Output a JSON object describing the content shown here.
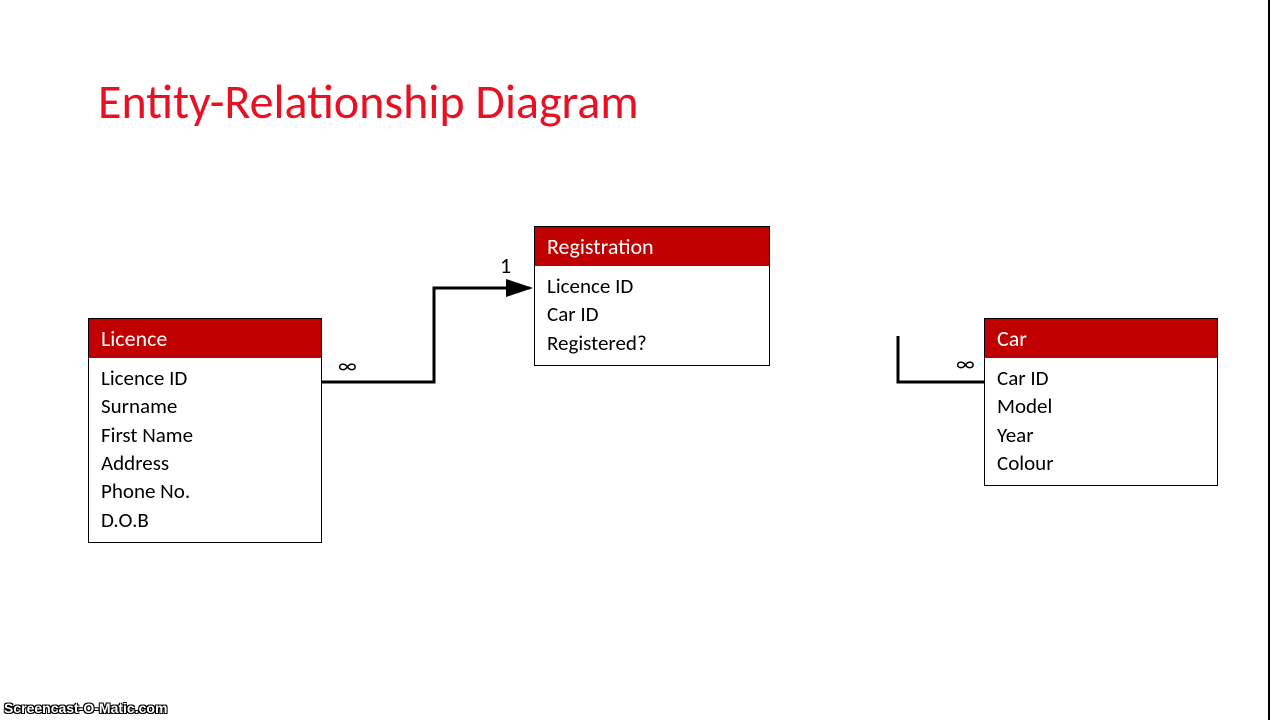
{
  "title": "Entity-Relationship Diagram",
  "entities": {
    "licence": {
      "name": "Licence",
      "fields": [
        "Licence ID",
        "Surname",
        "First Name",
        "Address",
        "Phone No.",
        "D.O.B"
      ]
    },
    "registration": {
      "name": "Registration",
      "fields": [
        "Licence ID",
        "Car ID",
        "Registered?"
      ]
    },
    "car": {
      "name": "Car",
      "fields": [
        "Car ID",
        "Model",
        "Year",
        "Colour"
      ]
    }
  },
  "connectors": {
    "licence_to_reg": {
      "from_label": "∞",
      "to_label": "1"
    },
    "car_to_reg": {
      "from_label": "∞"
    }
  },
  "watermark": "Screencast-O-Matic.com"
}
